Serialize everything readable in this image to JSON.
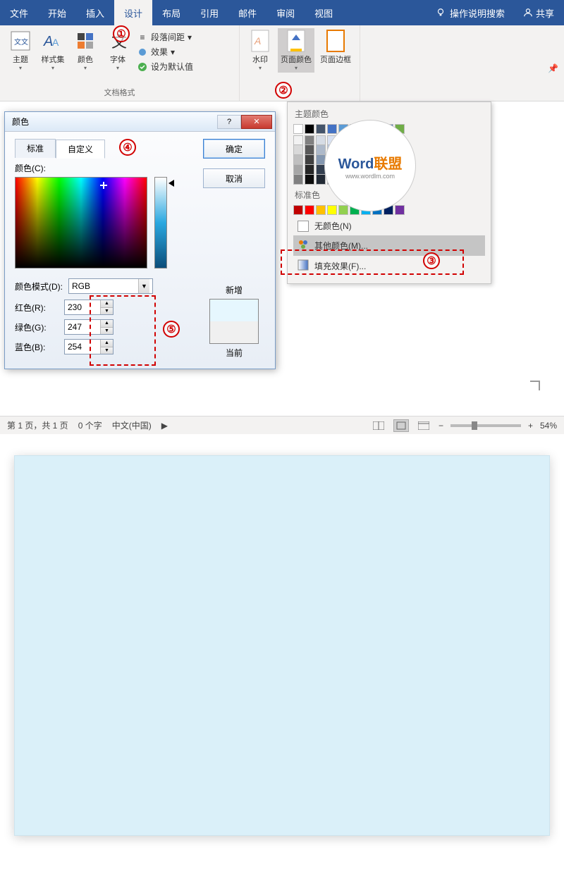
{
  "ribbon": {
    "tabs": [
      "文件",
      "开始",
      "插入",
      "设计",
      "布局",
      "引用",
      "邮件",
      "审阅",
      "视图"
    ],
    "active_tab": "设计",
    "help_search": "操作说明搜索",
    "share": "共享"
  },
  "design_group": {
    "themes": "主题",
    "styleset": "样式集",
    "colors": "颜色",
    "fonts": "字体",
    "para_spacing": "段落间距",
    "effects": "效果",
    "set_default": "设为默认值",
    "doc_format": "文档格式",
    "watermark": "水印",
    "page_color": "页面颜色",
    "page_border": "页面边框"
  },
  "dropdown": {
    "theme_colors": "主题颜色",
    "standard_colors": "标准色",
    "no_color": "无颜色(N)",
    "more_colors": "其他颜色(M)...",
    "fill_effects": "填充效果(F)...",
    "theme_row": [
      "#ffffff",
      "#000000",
      "#44546a",
      "#4472c4",
      "#5b9bd5",
      "#ed7d31",
      "#a5a5a5",
      "#ffc000",
      "#4472c4",
      "#70ad47"
    ],
    "std_row": [
      "#c00000",
      "#ff0000",
      "#ffc000",
      "#ffff00",
      "#92d050",
      "#00b050",
      "#00b0f0",
      "#0070c0",
      "#002060",
      "#7030a0"
    ]
  },
  "watermark_logo": {
    "w1": "Word",
    "w2": "联盟",
    "sub": "www.wordlm.com"
  },
  "dialog": {
    "title": "颜色",
    "tab_standard": "标准",
    "tab_custom": "自定义",
    "ok": "确定",
    "cancel": "取消",
    "color_label": "颜色(C):",
    "mode_label": "颜色模式(D):",
    "mode_value": "RGB",
    "red_label": "红色(R):",
    "green_label": "绿色(G):",
    "blue_label": "蓝色(B):",
    "red": "230",
    "green": "247",
    "blue": "254",
    "new_label": "新增",
    "current_label": "当前"
  },
  "status": {
    "page": "第 1 页，共 1 页",
    "words": "0 个字",
    "lang": "中文(中国)",
    "zoom": "54%"
  },
  "anno": {
    "a1": "①",
    "a2": "②",
    "a3": "③",
    "a4": "④",
    "a5": "⑤"
  }
}
